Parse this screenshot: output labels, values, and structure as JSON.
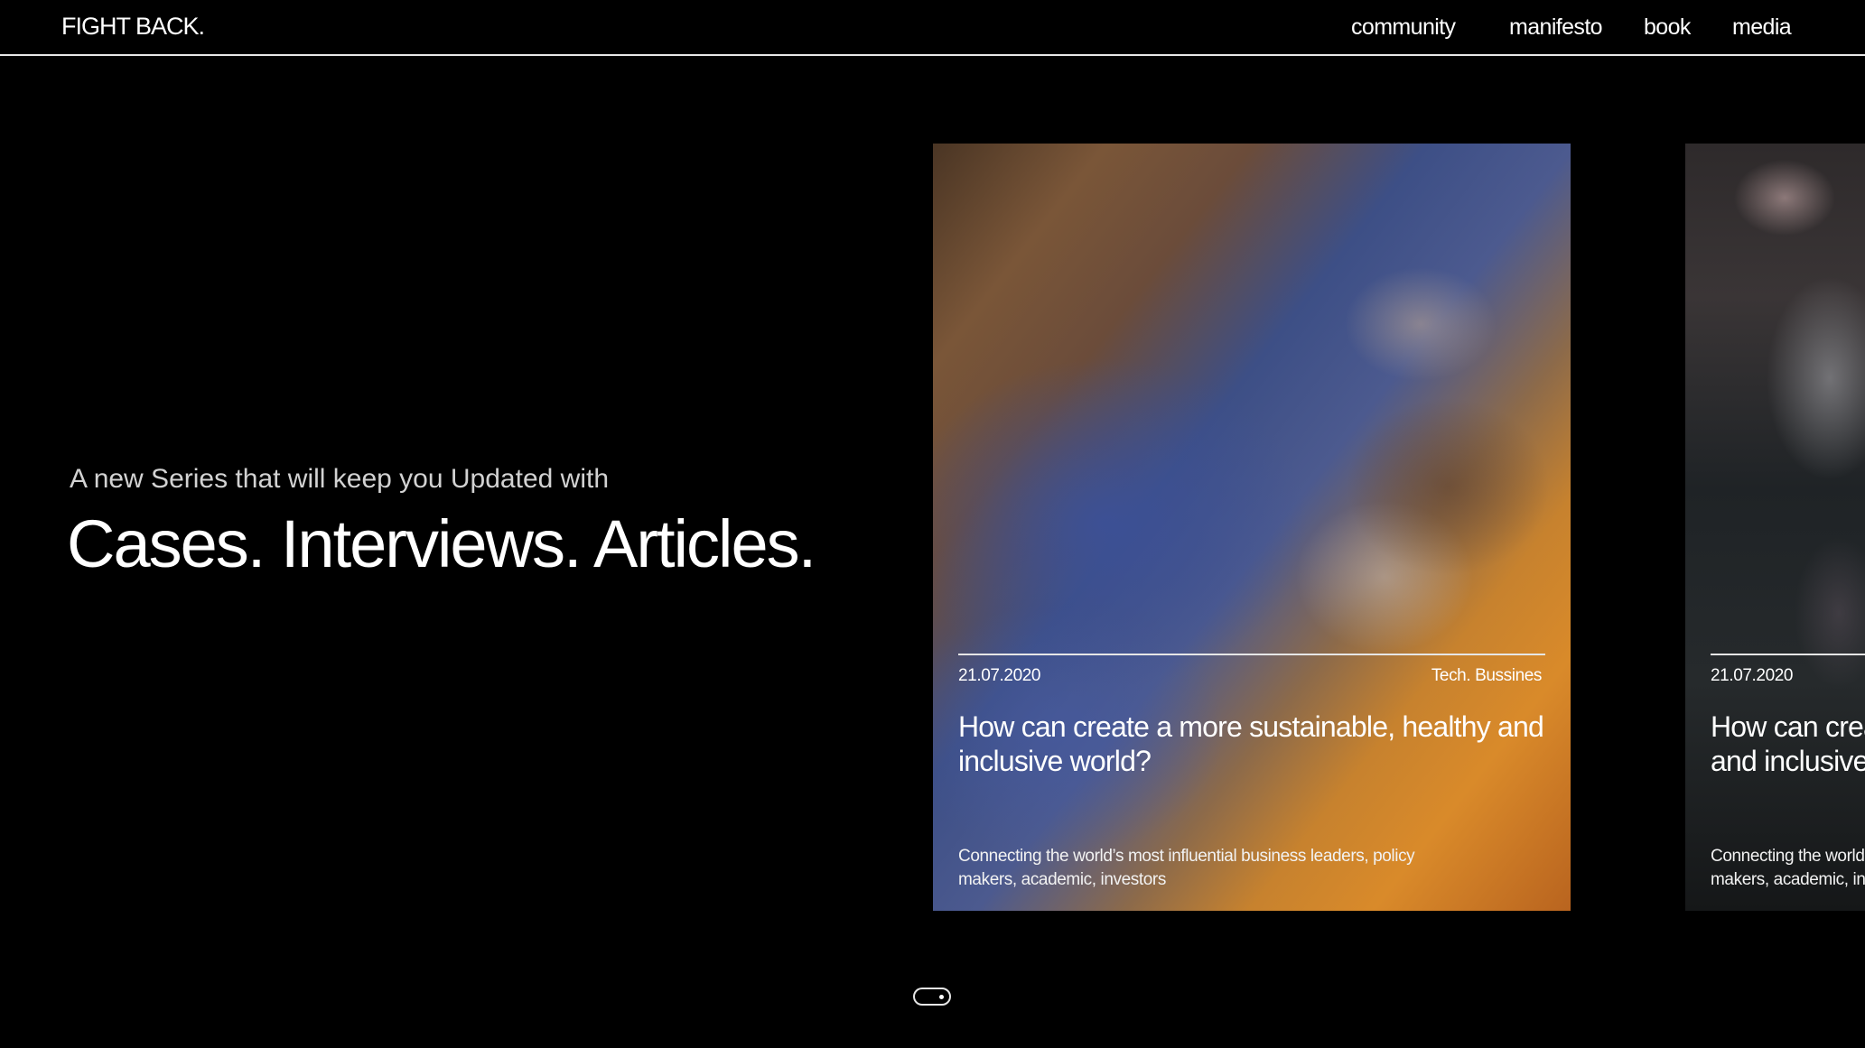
{
  "header": {
    "logo": "FIGHT BACK.",
    "nav": [
      "community",
      "manifesto",
      "book",
      "media"
    ]
  },
  "hero": {
    "subtitle": "A new Series that will keep you Updated with",
    "title": "Cases. Interviews. Articles."
  },
  "cards": [
    {
      "date": "21.07.2020",
      "category": "Tech. Bussines",
      "title": "How can create a more sustainable, healthy and inclusive world?",
      "description": "Connecting the world’s most influential business leaders, policy makers, academic, investors"
    },
    {
      "date": "21.07.2020",
      "title": "How can create a more sustainable, healthy and inclusive world?",
      "description": "Connecting the world’s most influential business leaders, policy makers, academic, investors"
    }
  ],
  "pager": {
    "icon": "pagination-toggle-icon"
  }
}
